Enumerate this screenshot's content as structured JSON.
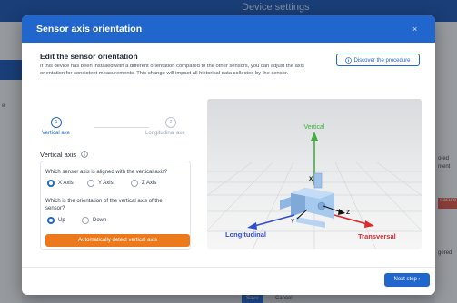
{
  "background": {
    "title": "Device settings",
    "left_text": "e",
    "right_texts": [
      "ored",
      "ntent",
      "easure",
      "gered"
    ],
    "save_label": "Save",
    "cancel_label": "Cancel"
  },
  "modal": {
    "title": "Sensor axis orientation",
    "close_glyph": "×",
    "section_title": "Edit the sensor orientation",
    "description": "If this device has been installed with a different orientation compared to the other sensors, you can adjust the axis orientation for consistent measurements. This change will impact all historical data collected by the sensor.",
    "discover_label": "Discover the procedure",
    "steps": [
      {
        "number": "1",
        "label": "Vertical axe"
      },
      {
        "number": "2",
        "label": "Longitudinal axe"
      }
    ],
    "axis_section_title": "Vertical axis",
    "q1": "Which sensor axis is aligned with the vertical axis?",
    "q1_options": [
      "X Axis",
      "Y Axis",
      "Z Axis"
    ],
    "q1_selected": "X Axis",
    "q2": "Which is the orientation of the vertical axis of the sensor?",
    "q2_options": [
      "Up",
      "Down"
    ],
    "q2_selected": "Up",
    "auto_detect_label": "Automatically detect vertical axis",
    "view3d": {
      "vertical_label": "Vertical",
      "longitudinal_label": "Longitudinal",
      "transversal_label": "Transversal",
      "axis_x": "X",
      "axis_y": "Y",
      "axis_z": "Z",
      "colors": {
        "vertical": "#3db23d",
        "longitudinal": "#2f4fd6",
        "transversal": "#e0282f",
        "sensor": "#8ab6e3"
      }
    },
    "next_label": "Next step",
    "next_glyph": "›"
  }
}
